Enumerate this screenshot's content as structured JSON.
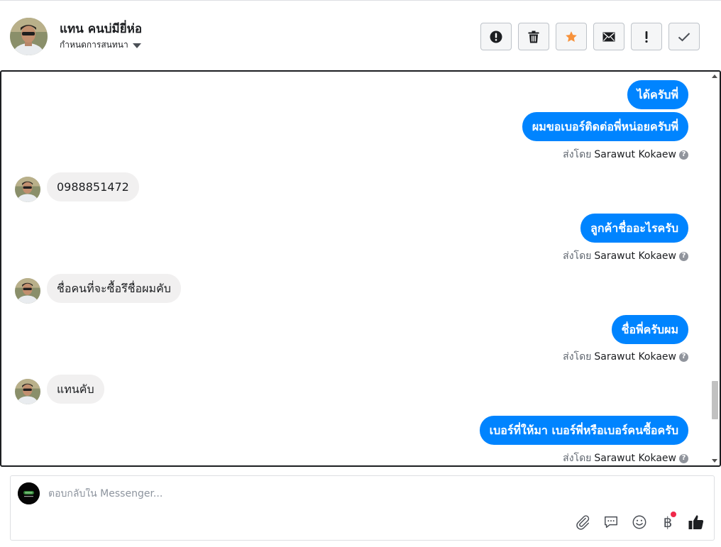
{
  "header": {
    "contact_name": "แทน คนบ่มียี่ห่อ",
    "conversation_settings": "กำหนดการสนทนา",
    "actions": [
      {
        "name": "spam-button",
        "icon": "exclamation-circle-icon"
      },
      {
        "name": "delete-button",
        "icon": "trash-icon"
      },
      {
        "name": "star-button",
        "icon": "star-icon",
        "color": "#f7923b"
      },
      {
        "name": "mark-unread-button",
        "icon": "envelope-icon"
      },
      {
        "name": "follow-up-button",
        "icon": "exclamation-icon"
      },
      {
        "name": "done-button",
        "icon": "check-icon"
      }
    ]
  },
  "messages": [
    {
      "direction": "out",
      "text": "ได้ครับพี่"
    },
    {
      "direction": "out",
      "text": "ผมขอเบอร์ติดต่อพี่หน่อยครับพี่"
    },
    {
      "type": "sent_by",
      "prefix": "ส่งโดย",
      "name": "Sarawut Kokaew"
    },
    {
      "direction": "in",
      "text": "0988851472"
    },
    {
      "direction": "out",
      "text": "ลูกค้าชื่ออะไรครับ"
    },
    {
      "type": "sent_by",
      "prefix": "ส่งโดย",
      "name": "Sarawut Kokaew"
    },
    {
      "direction": "in",
      "text": "ชื่อคนที่จะซื้อรึชื่อผมคับ"
    },
    {
      "direction": "out",
      "text": "ชื่อพี่ครับผม"
    },
    {
      "type": "sent_by",
      "prefix": "ส่งโดย",
      "name": "Sarawut Kokaew"
    },
    {
      "direction": "in",
      "text": "แทนคับ"
    },
    {
      "direction": "out",
      "text": "เบอร์ที่ให้มา เบอร์พี่หรือเบอร์คนซื้อครับ"
    },
    {
      "type": "sent_by",
      "prefix": "ส่งโดย",
      "name": "Sarawut Kokaew"
    }
  ],
  "composer": {
    "placeholder": "ตอบกลับใน Messenger...",
    "tools": [
      "paperclip-icon",
      "chat-bubble-icon",
      "smiley-icon",
      "baht-icon",
      "thumbs-up-icon"
    ],
    "baht_symbol": "฿"
  },
  "colors": {
    "outgoing_bubble": "#0084ff",
    "incoming_bubble": "#f1f0f0",
    "star": "#f7923b",
    "notification_dot": "#f0284a"
  }
}
